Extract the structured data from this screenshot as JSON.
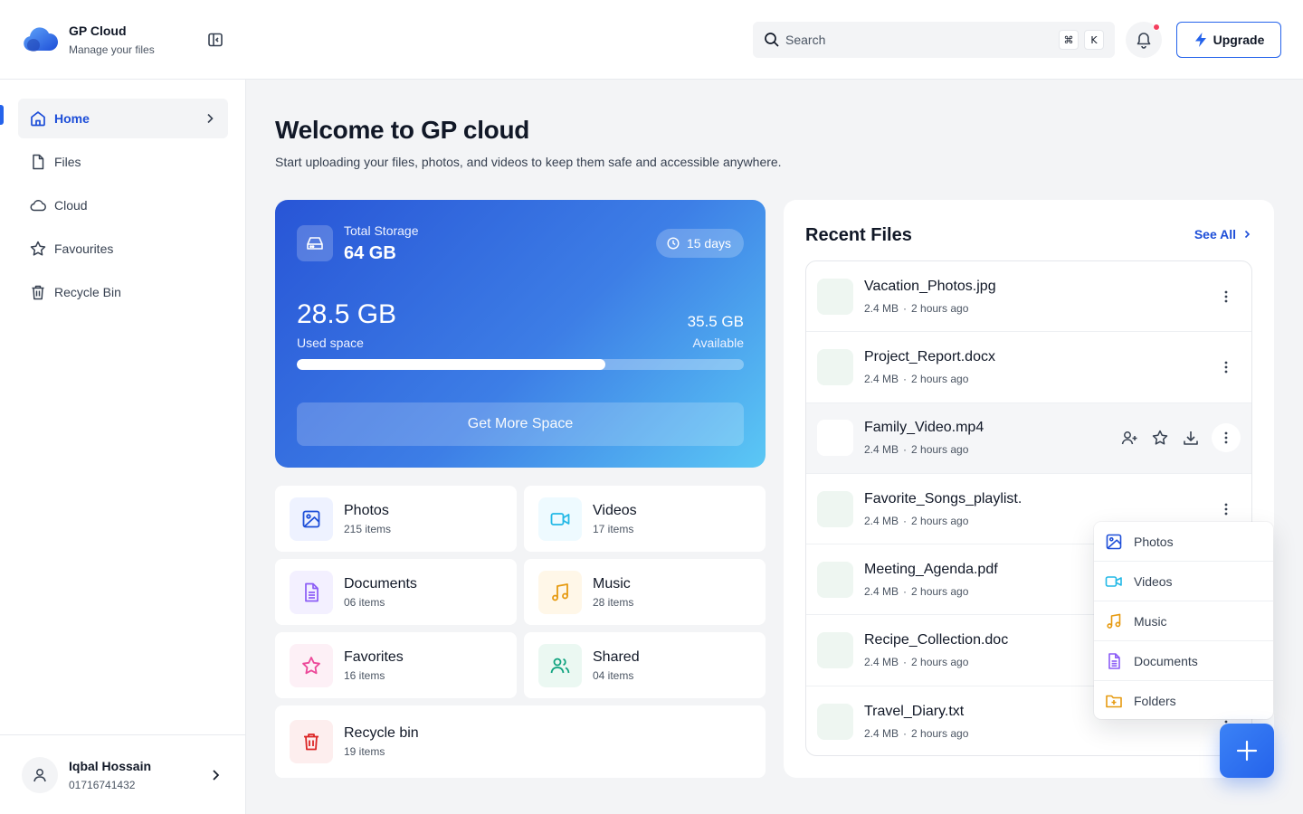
{
  "app": {
    "name": "GP Cloud",
    "tagline": "Manage your files"
  },
  "search": {
    "placeholder": "Search",
    "shortcut_mod": "⌘",
    "shortcut_key": "K"
  },
  "header": {
    "upgrade_label": "Upgrade"
  },
  "sidebar": {
    "items": [
      {
        "label": "Home",
        "icon": "home-icon",
        "active": true
      },
      {
        "label": "Files",
        "icon": "file-icon"
      },
      {
        "label": "Cloud",
        "icon": "cloud-icon"
      },
      {
        "label": "Favourites",
        "icon": "star-icon"
      },
      {
        "label": "Recycle Bin",
        "icon": "trash-icon"
      }
    ]
  },
  "user": {
    "name": "Iqbal Hossain",
    "phone": "01716741432"
  },
  "welcome": {
    "title": "Welcome to GP cloud",
    "subtitle": "Start uploading your files, photos, and videos to keep them safe and accessible anywhere."
  },
  "storage": {
    "label": "Total Storage",
    "total": "64 GB",
    "days": "15 days",
    "used": "28.5 GB",
    "used_label": "Used space",
    "available": "35.5 GB",
    "available_label": "Available",
    "used_fraction": 0.69,
    "button_label": "Get More Space"
  },
  "categories": [
    {
      "name": "Photos",
      "count": "215 items",
      "icon": "image-icon",
      "color": "#1d4ed8",
      "bg": "#eef2ff"
    },
    {
      "name": "Videos",
      "count": "17 items",
      "icon": "video-icon",
      "color": "#22b8e6",
      "bg": "#eefaff"
    },
    {
      "name": "Documents",
      "count": "06 items",
      "icon": "document-icon",
      "color": "#8b5cf6",
      "bg": "#f3f0ff"
    },
    {
      "name": "Music",
      "count": "28 items",
      "icon": "music-icon",
      "color": "#e69a10",
      "bg": "#fff7e8"
    },
    {
      "name": "Favorites",
      "count": "16 items",
      "icon": "star-icon",
      "color": "#ec4899",
      "bg": "#fdf0f6"
    },
    {
      "name": "Shared",
      "count": "04 items",
      "icon": "users-icon",
      "color": "#10a37f",
      "bg": "#ebf8f2"
    },
    {
      "name": "Recycle bin",
      "count": "19 items",
      "icon": "trash-icon",
      "color": "#dc2626",
      "bg": "#fdeeee"
    }
  ],
  "recent": {
    "title": "Recent Files",
    "see_all": "See All",
    "files": [
      {
        "name": "Vacation_Photos.jpg",
        "size": "2.4 MB",
        "time": "2 hours ago"
      },
      {
        "name": "Project_Report.docx",
        "size": "2.4 MB",
        "time": "2 hours ago"
      },
      {
        "name": "Family_Video.mp4",
        "size": "2.4 MB",
        "time": "2 hours ago"
      },
      {
        "name": "Favorite_Songs_playlist.",
        "size": "2.4 MB",
        "time": "2 hours ago"
      },
      {
        "name": "Meeting_Agenda.pdf",
        "size": "2.4 MB",
        "time": "2 hours ago"
      },
      {
        "name": "Recipe_Collection.doc",
        "size": "2.4 MB",
        "time": "2 hours ago"
      },
      {
        "name": "Travel_Diary.txt",
        "size": "2.4 MB",
        "time": "2 hours ago"
      }
    ],
    "meta_separator": "·"
  },
  "upload_menu": {
    "items": [
      {
        "label": "Photos",
        "icon": "image-icon",
        "color": "#1d4ed8"
      },
      {
        "label": "Videos",
        "icon": "video-icon",
        "color": "#22b8e6"
      },
      {
        "label": "Music",
        "icon": "music-icon",
        "color": "#e69a10"
      },
      {
        "label": "Documents",
        "icon": "document-icon",
        "color": "#8b5cf6"
      },
      {
        "label": "Folders",
        "icon": "folder-plus-icon",
        "color": "#e69a10"
      }
    ]
  },
  "colors": {
    "accent": "#2563eb",
    "notification_dot": "#f43f5e"
  }
}
